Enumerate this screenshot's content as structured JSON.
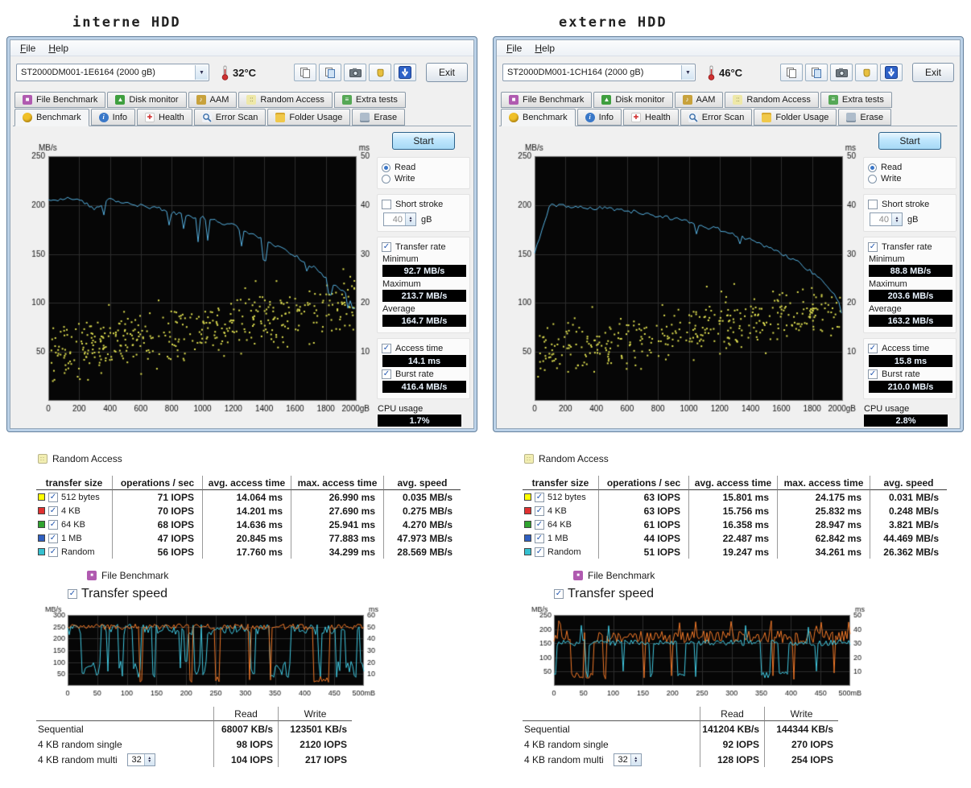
{
  "chrome": {
    "menu": [
      "File",
      "Help"
    ],
    "exit_label": "Exit",
    "tabs_top": [
      {
        "name": "file-benchmark",
        "label": "File Benchmark",
        "bg": "#b05ab0",
        "glyph": "■"
      },
      {
        "name": "disk-monitor",
        "label": "Disk monitor",
        "bg": "#3f9f3f",
        "glyph": "▲"
      },
      {
        "name": "aam",
        "label": "AAM",
        "bg": "#c8a23c",
        "glyph": "♪"
      },
      {
        "name": "random-access",
        "label": "Random Access",
        "bg": "#eee8a8",
        "fg": "#77723a",
        "glyph": "::"
      },
      {
        "name": "extra-tests",
        "label": "Extra tests",
        "bg": "#56a856",
        "glyph": "≡"
      }
    ],
    "tabs_bottom": [
      {
        "name": "benchmark",
        "label": "Benchmark",
        "bg": "#f0c028",
        "glyph": "",
        "active": true
      },
      {
        "name": "info",
        "label": "Info",
        "bg": "#3a78c8",
        "glyph": "i"
      },
      {
        "name": "health",
        "label": "Health",
        "bg": "#ffffff",
        "fg": "#d03030",
        "glyph": "✚"
      },
      {
        "name": "error-scan",
        "label": "Error Scan",
        "bg": "#eef2f8",
        "shape": "magnifier",
        "glyph": ""
      },
      {
        "name": "folder-usage",
        "label": "Folder Usage",
        "bg": "#f0c84a",
        "glyph": ""
      },
      {
        "name": "erase",
        "label": "Erase",
        "bg": "#aebccb",
        "glyph": ""
      }
    ],
    "side": {
      "start": "Start",
      "read": "Read",
      "write": "Write",
      "short_stroke": "Short stroke",
      "unit_gb": "gB",
      "transfer_rate": "Transfer rate",
      "minimum": "Minimum",
      "maximum": "Maximum",
      "average": "Average",
      "access_time": "Access time",
      "burst_rate": "Burst rate",
      "cpu_usage": "CPU usage"
    },
    "ra": {
      "title": "Random Access",
      "icon_glyph": "::",
      "headers": [
        "transfer size",
        "operations / sec",
        "avg. access time",
        "max. access time",
        "avg. speed"
      ]
    },
    "fb": {
      "title": "File Benchmark",
      "icon_glyph": "■",
      "transfer_speed": "Transfer speed",
      "read": "Read",
      "write": "Write",
      "rows": [
        "Sequential",
        "4 KB random single",
        "4 KB random multi"
      ]
    }
  },
  "windows": [
    {
      "caption": "interne HDD",
      "drive": "ST2000DM001-1E6164 (2000 gB)",
      "temperature": "32°C",
      "short_stroke_value": "40",
      "values": {
        "minimum": "92.7 MB/s",
        "maximum": "213.7 MB/s",
        "average": "164.7 MB/s",
        "access_time": "14.1 ms",
        "burst_rate": "416.4 MB/s",
        "cpu_usage": "1.7%"
      },
      "ra_rows": [
        {
          "color": "#ffff00",
          "label": "512 bytes",
          "ops": "71 IOPS",
          "avg": "14.064 ms",
          "max": "26.990 ms",
          "speed": "0.035 MB/s"
        },
        {
          "color": "#e03030",
          "label": "4 KB",
          "ops": "70 IOPS",
          "avg": "14.201 ms",
          "max": "27.690 ms",
          "speed": "0.275 MB/s"
        },
        {
          "color": "#2fa32f",
          "label": "64 KB",
          "ops": "68 IOPS",
          "avg": "14.636 ms",
          "max": "25.941 ms",
          "speed": "4.270 MB/s"
        },
        {
          "color": "#2f5fc0",
          "label": "1 MB",
          "ops": "47 IOPS",
          "avg": "20.845 ms",
          "max": "77.883 ms",
          "speed": "47.973 MB/s"
        },
        {
          "color": "#35c0d0",
          "label": "Random",
          "ops": "56 IOPS",
          "avg": "17.760 ms",
          "max": "34.299 ms",
          "speed": "28.569 MB/s"
        }
      ],
      "fb_values": {
        "multi_count": "32",
        "seq_read": "68007 KB/s",
        "seq_write": "123501 KB/s",
        "single_read": "98 IOPS",
        "single_write": "2120 IOPS",
        "multi_read": "104 IOPS",
        "multi_write": "217 IOPS"
      }
    },
    {
      "caption": "externe HDD",
      "drive": "ST2000DM001-1CH164 (2000 gB)",
      "temperature": "46°C",
      "short_stroke_value": "40",
      "values": {
        "minimum": "88.8 MB/s",
        "maximum": "203.6 MB/s",
        "average": "163.2 MB/s",
        "access_time": "15.8 ms",
        "burst_rate": "210.0 MB/s",
        "cpu_usage": "2.8%"
      },
      "ra_rows": [
        {
          "color": "#ffff00",
          "label": "512 bytes",
          "ops": "63 IOPS",
          "avg": "15.801 ms",
          "max": "24.175 ms",
          "speed": "0.031 MB/s"
        },
        {
          "color": "#e03030",
          "label": "4 KB",
          "ops": "63 IOPS",
          "avg": "15.756 ms",
          "max": "25.832 ms",
          "speed": "0.248 MB/s"
        },
        {
          "color": "#2fa32f",
          "label": "64 KB",
          "ops": "61 IOPS",
          "avg": "16.358 ms",
          "max": "28.947 ms",
          "speed": "3.821 MB/s"
        },
        {
          "color": "#2f5fc0",
          "label": "1 MB",
          "ops": "44 IOPS",
          "avg": "22.487 ms",
          "max": "62.842 ms",
          "speed": "44.469 MB/s"
        },
        {
          "color": "#35c0d0",
          "label": "Random",
          "ops": "51 IOPS",
          "avg": "19.247 ms",
          "max": "34.261 ms",
          "speed": "26.362 MB/s"
        }
      ],
      "fb_values": {
        "multi_count": "32",
        "seq_read": "141204 KB/s",
        "seq_write": "144344 KB/s",
        "single_read": "92 IOPS",
        "single_write": "270 IOPS",
        "multi_read": "128 IOPS",
        "multi_write": "254 IOPS"
      }
    }
  ],
  "chart_data": {
    "benchmark": [
      {
        "type": "line+scatter",
        "title": "Benchmark transfer rate (interne HDD)",
        "x_max": 2000,
        "x_tick_step": 200,
        "x_end_suffix": "gB",
        "y_left": {
          "label": "MB/s",
          "max": 250,
          "ticks": [
            50,
            100,
            150,
            200,
            250
          ]
        },
        "y_right": {
          "label": "ms",
          "max": 50,
          "ticks": [
            10,
            20,
            30,
            40,
            50
          ]
        },
        "transfer_x_step": 100,
        "transfer_mbs": [
          204,
          207,
          205,
          196,
          206,
          203,
          199,
          197,
          193,
          189,
          187,
          183,
          179,
          171,
          164,
          156,
          148,
          139,
          126,
          113,
          97
        ],
        "access_scatter": {
          "ms_start": 10,
          "ms_end": 19.5,
          "spread": 5.5,
          "count": 430
        },
        "noise": {
          "dip_prob": 0.1,
          "dip_amp": 42,
          "min": 93,
          "max": 213.7
        },
        "line_color": "#55b0e0",
        "scatter_color": "#dede50",
        "seed": 11
      },
      {
        "type": "line+scatter",
        "title": "Benchmark transfer rate (externe HDD)",
        "x_max": 2000,
        "x_tick_step": 200,
        "x_end_suffix": "gB",
        "y_left": {
          "label": "MB/s",
          "max": 250,
          "ticks": [
            50,
            100,
            150,
            200,
            250
          ]
        },
        "y_right": {
          "label": "ms",
          "max": 50,
          "ticks": [
            10,
            20,
            30,
            40,
            50
          ]
        },
        "transfer_x_step": 100,
        "transfer_mbs": [
          152,
          200,
          199,
          198,
          197,
          196,
          194,
          192,
          189,
          186,
          183,
          179,
          175,
          170,
          164,
          158,
          151,
          142,
          131,
          117,
          96
        ],
        "access_scatter": {
          "ms_start": 9.5,
          "ms_end": 18.5,
          "spread": 5,
          "count": 380
        },
        "noise": {
          "dip_prob": 0.04,
          "dip_amp": 22,
          "min": 89,
          "max": 203.6
        },
        "line_color": "#55b0e0",
        "scatter_color": "#dede50",
        "seed": 22
      }
    ],
    "file": [
      {
        "type": "line",
        "title": "File benchmark transfer speed (interne HDD)",
        "x_max": 500,
        "x_tick_step": 50,
        "x_end_suffix": "mB",
        "y_left": {
          "label": "MB/s",
          "max": 300,
          "ticks": [
            50,
            100,
            150,
            200,
            250,
            300
          ]
        },
        "y_right": {
          "label": "ms",
          "max": 60,
          "ticks": [
            10,
            20,
            30,
            40,
            50,
            60
          ]
        },
        "seed": 33,
        "series": [
          {
            "name": "read",
            "color": "#40c8e0",
            "high": 238,
            "hvar": 45,
            "low": 70,
            "lvar": 70,
            "p_dip": 0.13,
            "p_rise": 0.3,
            "spike": 0
          },
          {
            "name": "write",
            "color": "#f07828",
            "high": 250,
            "hvar": 25,
            "low": 28,
            "lvar": 28,
            "p_dip": 0.05,
            "p_rise": 0.35,
            "spike": 0
          }
        ]
      },
      {
        "type": "line",
        "title": "File benchmark transfer speed (externe HDD)",
        "x_max": 500,
        "x_tick_step": 50,
        "x_end_suffix": "mB",
        "y_left": {
          "label": "MB/s",
          "max": 250,
          "ticks": [
            50,
            100,
            150,
            200,
            250
          ]
        },
        "y_right": {
          "label": "ms",
          "max": 50,
          "ticks": [
            10,
            20,
            30,
            40,
            50
          ]
        },
        "seed": 44,
        "series": [
          {
            "name": "write",
            "color": "#f07828",
            "high": 172,
            "hvar": 45,
            "low": 35,
            "lvar": 25,
            "p_dip": 0.05,
            "p_rise": 0.4,
            "spike": 220
          },
          {
            "name": "read",
            "color": "#40c8e0",
            "high": 152,
            "hvar": 22,
            "low": 40,
            "lvar": 25,
            "p_dip": 0.04,
            "p_rise": 0.4,
            "spike": 215
          }
        ]
      }
    ]
  }
}
